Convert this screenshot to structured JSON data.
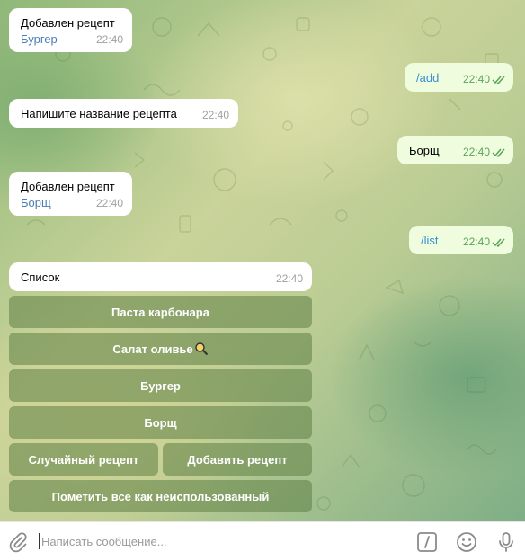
{
  "messages": [
    {
      "side": "in",
      "text": "Добавлен рецепт",
      "link": "Бургер",
      "time": "22:40"
    },
    {
      "side": "out",
      "text": "/add",
      "time": "22:40"
    },
    {
      "side": "in",
      "text": "Напишите название рецепта",
      "time": "22:40"
    },
    {
      "side": "out",
      "text": "Борщ",
      "time": "22:40"
    },
    {
      "side": "in",
      "text": "Добавлен рецепт",
      "link": "Борщ",
      "time": "22:40"
    },
    {
      "side": "out",
      "text": "/list",
      "time": "22:40"
    },
    {
      "side": "in",
      "text": "Список",
      "time": "22:40"
    }
  ],
  "keyboard": {
    "b1": "Паста карбонара",
    "b2": "Салат оливье",
    "b2_emoji": "magnifier-emoji",
    "b3": "Бургер",
    "b4": "Борщ",
    "b5": "Случайный рецепт",
    "b6": "Добавить рецепт",
    "b7": "Пометить все как неиспользованный"
  },
  "input": {
    "placeholder": "Написать сообщение..."
  },
  "icons": {
    "attach": "paperclip-icon",
    "command": "slash-command-icon",
    "emoji": "smiley-icon",
    "voice": "microphone-icon"
  },
  "colors": {
    "incoming_bubble": "#ffffff",
    "outgoing_bubble": "#effdde",
    "keyboard_button": "#5f8046",
    "read_checks": "#5ba35b",
    "link": "#4a7fb5"
  }
}
